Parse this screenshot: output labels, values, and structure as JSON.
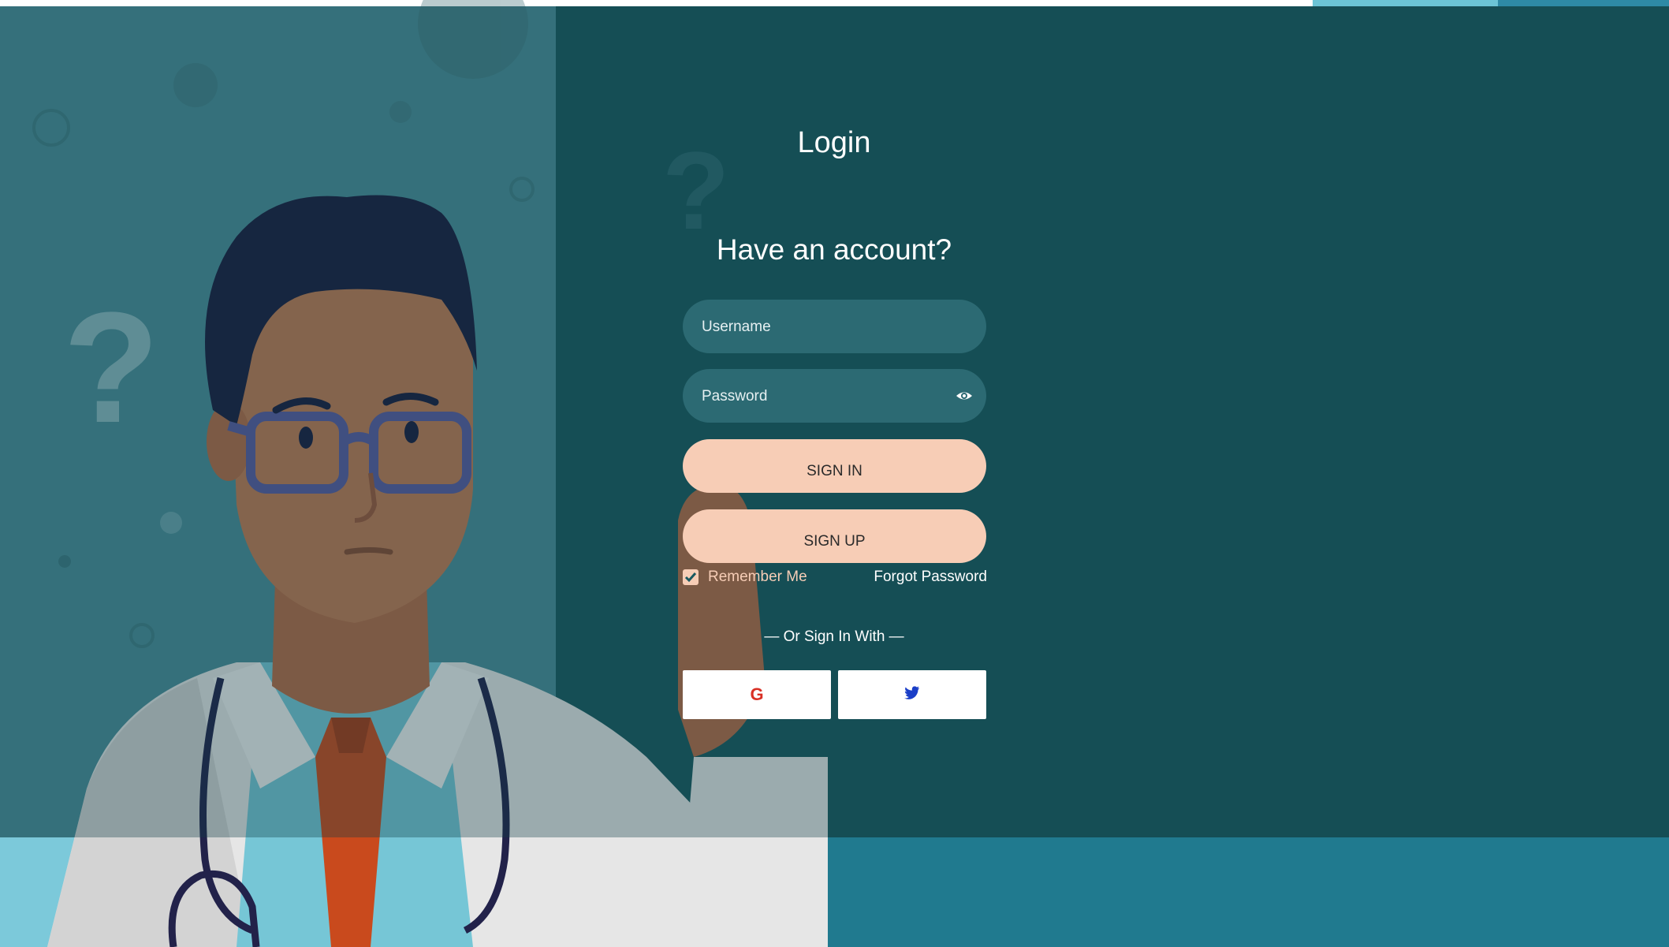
{
  "login": {
    "title": "Login",
    "subtitle": "Have an account?",
    "username_placeholder": "Username",
    "password_placeholder": "Password",
    "sign_in_label": "SIGN IN",
    "sign_up_label": "SIGN UP",
    "remember_label": "Remember Me",
    "remember_checked": true,
    "forgot_label": "Forgot Password",
    "or_label": "— Or Sign In With —",
    "google_label": "G",
    "twitter_icon": "twitter-icon"
  },
  "colors": {
    "background_dark": "#19585f",
    "left_panel": "#4b8d98",
    "button_peach": "#f7cdb6",
    "input_fill": "#2c6a73",
    "google_red": "#d93025",
    "twitter_blue": "#1a3ec7"
  }
}
